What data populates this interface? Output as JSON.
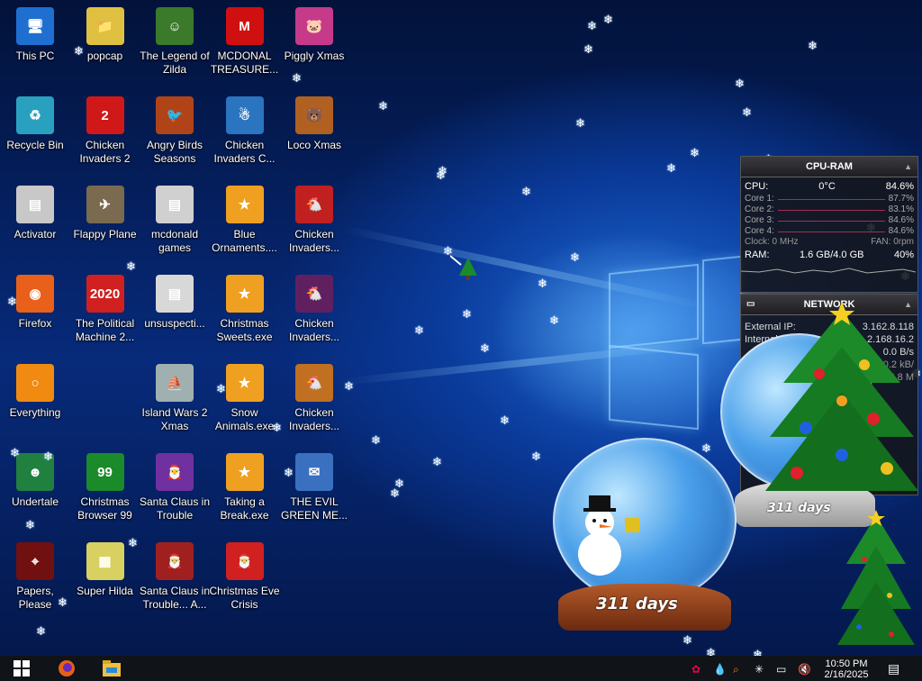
{
  "desktop": {
    "icons": [
      {
        "label": "This PC",
        "color": "#1e6fd0",
        "glyph": "🖥",
        "shortcut": false
      },
      {
        "label": "popcap",
        "color": "#e0c040",
        "glyph": "📁",
        "shortcut": false
      },
      {
        "label": "The Legend of Zilda",
        "color": "#3a7a2a",
        "glyph": "☺",
        "shortcut": true
      },
      {
        "label": "MCDONAL TREASURE...",
        "color": "#d01010",
        "glyph": "M",
        "shortcut": true
      },
      {
        "label": "Piggly Xmas",
        "color": "#c63a8a",
        "glyph": "🐷",
        "shortcut": false
      },
      {
        "label": "Recycle Bin",
        "color": "#2aa0c0",
        "glyph": "♻",
        "shortcut": false
      },
      {
        "label": "Chicken Invaders 2",
        "color": "#d01818",
        "glyph": "2",
        "shortcut": false
      },
      {
        "label": "Angry Birds Seasons",
        "color": "#b04418",
        "glyph": "🐦",
        "shortcut": false
      },
      {
        "label": "Chicken Invaders C...",
        "color": "#2a74c0",
        "glyph": "☃",
        "shortcut": true
      },
      {
        "label": "Loco Xmas",
        "color": "#b06020",
        "glyph": "🐻",
        "shortcut": false
      },
      {
        "label": "Activator",
        "color": "#c8c8c8",
        "glyph": "▤",
        "shortcut": false
      },
      {
        "label": "Flappy Plane",
        "color": "#7a6a50",
        "glyph": "✈",
        "shortcut": false
      },
      {
        "label": "mcdonald games",
        "color": "#d0d0d0",
        "glyph": "▤",
        "shortcut": false
      },
      {
        "label": "Blue Ornaments....",
        "color": "#f0a020",
        "glyph": "★",
        "shortcut": true
      },
      {
        "label": "Chicken Invaders...",
        "color": "#c02020",
        "glyph": "🐔",
        "shortcut": false
      },
      {
        "label": "Firefox",
        "color": "#e8601a",
        "glyph": "◉",
        "shortcut": true
      },
      {
        "label": "The Political Machine 2...",
        "color": "#d02020",
        "glyph": "2020",
        "shortcut": false
      },
      {
        "label": "unsuspecti...",
        "color": "#d8d8d8",
        "glyph": "▤",
        "shortcut": false
      },
      {
        "label": "Christmas Sweets.exe",
        "color": "#f0a020",
        "glyph": "★",
        "shortcut": true
      },
      {
        "label": "Chicken Invaders...",
        "color": "#602060",
        "glyph": "🐔",
        "shortcut": false
      },
      {
        "label": "Everything",
        "color": "#f08a10",
        "glyph": "○",
        "shortcut": true
      },
      {
        "label": "",
        "color": "",
        "glyph": "",
        "shortcut": false,
        "empty": true
      },
      {
        "label": "Island Wars 2 Xmas",
        "color": "#a0b0b0",
        "glyph": "⛵",
        "shortcut": false
      },
      {
        "label": "Snow Animals.exe",
        "color": "#f0a020",
        "glyph": "★",
        "shortcut": true
      },
      {
        "label": "Chicken Invaders...",
        "color": "#c07020",
        "glyph": "🐔",
        "shortcut": false
      },
      {
        "label": "Undertale",
        "color": "#208040",
        "glyph": "☻",
        "shortcut": true
      },
      {
        "label": "Christmas Browser 99",
        "color": "#1a8a2a",
        "glyph": "99",
        "shortcut": true
      },
      {
        "label": "Santa Claus in Trouble",
        "color": "#7030a0",
        "glyph": "🎅",
        "shortcut": true
      },
      {
        "label": "Taking a Break.exe",
        "color": "#f0a020",
        "glyph": "★",
        "shortcut": true
      },
      {
        "label": "THE EVIL GREEN ME...",
        "color": "#3a70c0",
        "glyph": "✉",
        "shortcut": false
      },
      {
        "label": "Papers, Please",
        "color": "#701010",
        "glyph": "⌖",
        "shortcut": true
      },
      {
        "label": "Super Hilda",
        "color": "#d8d060",
        "glyph": "▦",
        "shortcut": false
      },
      {
        "label": "Santa Claus in Trouble... A...",
        "color": "#a02020",
        "glyph": "🎅",
        "shortcut": true
      },
      {
        "label": "Christmas Eve Crisis",
        "color": "#d02020",
        "glyph": "🎅",
        "shortcut": false
      }
    ]
  },
  "cpu_gadget": {
    "title": "CPU-RAM",
    "rows": [
      {
        "label": "CPU:",
        "mid": "0°C",
        "value": "84.6%"
      },
      {
        "label": "Core 1:",
        "value": "87.7%"
      },
      {
        "label": "Core 2:",
        "value": "83.1%"
      },
      {
        "label": "Core 3:",
        "value": "84.6%"
      },
      {
        "label": "Core 4:",
        "value": "84.6%"
      }
    ],
    "clock": "Clock: 0 MHz",
    "fan": "FAN: 0rpm",
    "ram_label": "RAM:",
    "ram_value": "1.6 GB/4.0 GB",
    "ram_pct": "40%"
  },
  "network_gadget": {
    "title": "NETWORK",
    "external_label": "External IP:",
    "external_value": "3.162.8.118",
    "internal_label": "Internal",
    "internal_value": "2.168.16.2",
    "rate": "0.0 B/s",
    "rate2": "0.2 kB/",
    "rate3": "38.8 M"
  },
  "globes": {
    "left_days": "311 days",
    "right_days": "311 days"
  },
  "taskbar": {
    "time": "10:50 PM",
    "date": "2/16/2025"
  }
}
